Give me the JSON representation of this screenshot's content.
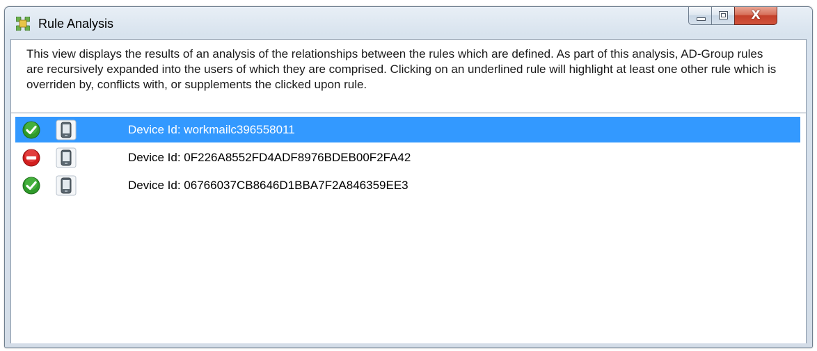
{
  "window": {
    "title": "Rule Analysis",
    "controls": {
      "close_glyph": "X"
    }
  },
  "description": "This view displays the results of an analysis of the relationships between the rules which are defined. As part of this analysis, AD-Group rules are recursively expanded into the users of which they are comprised. Clicking on an underlined rule will highlight at least one other rule which is overriden by, conflicts with, or supplements the clicked upon rule.",
  "rules": [
    {
      "status": "allow",
      "status_icon": "green-check-icon",
      "type_icon": "device-icon",
      "label": "Device Id: workmailc396558011",
      "selected": true
    },
    {
      "status": "deny",
      "status_icon": "red-no-entry-icon",
      "type_icon": "device-icon",
      "label": "Device Id: 0F226A8552FD4ADF8976BDEB00F2FA42",
      "selected": false
    },
    {
      "status": "allow",
      "status_icon": "green-check-icon",
      "type_icon": "device-icon",
      "label": "Device Id: 06766037CB8646D1BBA7F2A846359EE3",
      "selected": false
    }
  ],
  "colors": {
    "selection": "#3399ff",
    "allow": "#2f9a2a",
    "deny": "#d21f1f",
    "close_button": "#c4402a"
  }
}
